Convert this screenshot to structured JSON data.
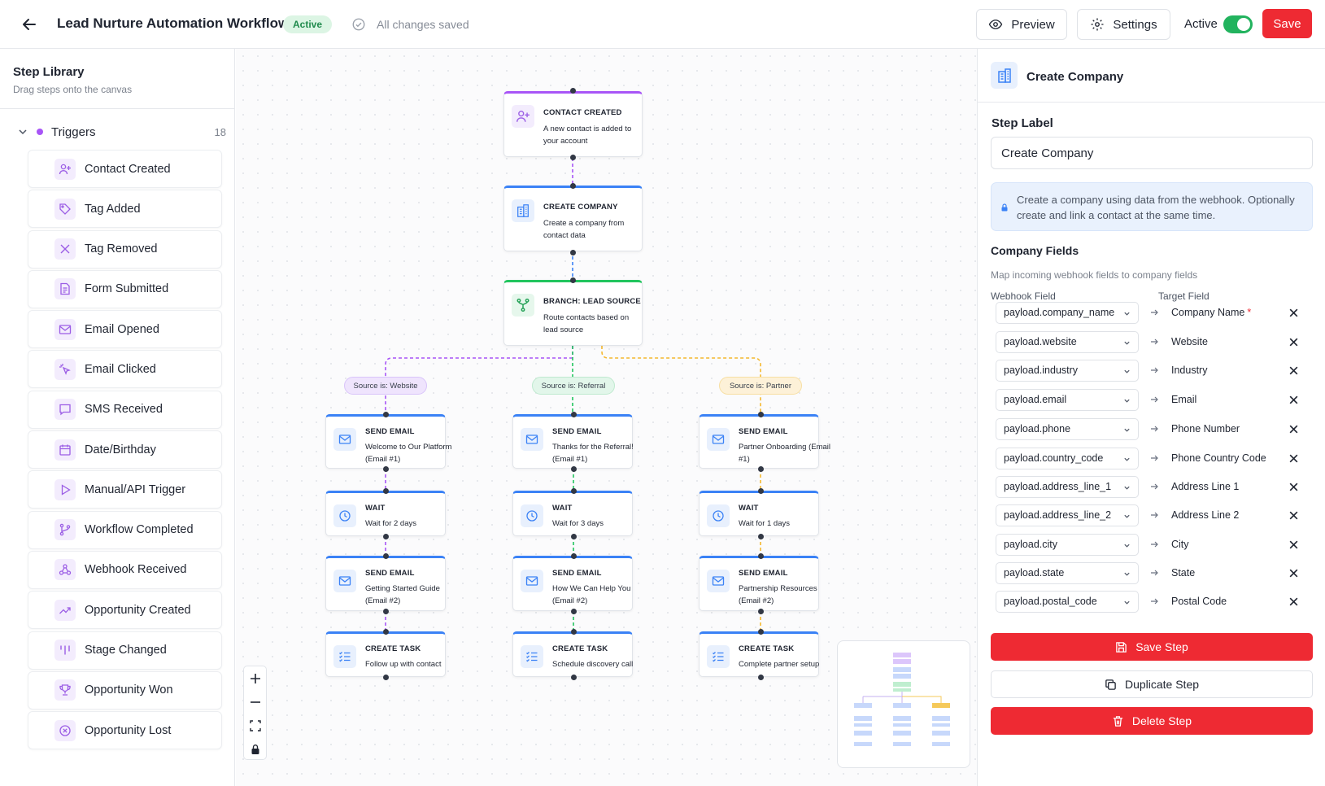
{
  "header": {
    "title": "Lead Nurture Automation Workflow",
    "status_badge": "Active",
    "save_status": "All changes saved",
    "preview_label": "Preview",
    "settings_label": "Settings",
    "active_label": "Active",
    "active_on": true,
    "save_label": "Save"
  },
  "sidebar": {
    "title": "Step Library",
    "subtitle": "Drag steps onto the canvas",
    "group_label": "Triggers",
    "group_count": "18",
    "items": [
      {
        "label": "Contact Created",
        "icon": "user-plus-icon"
      },
      {
        "label": "Tag Added",
        "icon": "tag-icon"
      },
      {
        "label": "Tag Removed",
        "icon": "x-icon"
      },
      {
        "label": "Form Submitted",
        "icon": "document-icon"
      },
      {
        "label": "Email Opened",
        "icon": "mail-icon"
      },
      {
        "label": "Email Clicked",
        "icon": "cursor-click-icon"
      },
      {
        "label": "SMS Received",
        "icon": "chat-icon"
      },
      {
        "label": "Date/Birthday",
        "icon": "calendar-icon"
      },
      {
        "label": "Manual/API Trigger",
        "icon": "play-icon"
      },
      {
        "label": "Workflow Completed",
        "icon": "branch-icon"
      },
      {
        "label": "Webhook Received",
        "icon": "webhook-icon"
      },
      {
        "label": "Opportunity Created",
        "icon": "trend-up-icon"
      },
      {
        "label": "Stage Changed",
        "icon": "columns-icon"
      },
      {
        "label": "Opportunity Won",
        "icon": "trophy-icon"
      },
      {
        "label": "Opportunity Lost",
        "icon": "x-circle-icon"
      }
    ]
  },
  "canvas": {
    "trigger": {
      "title": "CONTACT CREATED",
      "desc": "A new contact is added to your account"
    },
    "create_company": {
      "title": "CREATE COMPANY",
      "desc": "Create a company from contact data"
    },
    "branch": {
      "title": "BRANCH: LEAD SOURCE",
      "desc": "Route contacts based on lead source"
    },
    "branches": [
      {
        "label": "Source is: Website",
        "steps": [
          {
            "title": "SEND EMAIL",
            "desc": "Welcome to Our Platform (Email #1)"
          },
          {
            "title": "WAIT",
            "desc": "Wait for 2 days"
          },
          {
            "title": "SEND EMAIL",
            "desc": "Getting Started Guide (Email #2)"
          },
          {
            "title": "CREATE TASK",
            "desc": "Follow up with contact"
          }
        ]
      },
      {
        "label": "Source is: Referral",
        "steps": [
          {
            "title": "SEND EMAIL",
            "desc": "Thanks for the Referral! (Email #1)"
          },
          {
            "title": "WAIT",
            "desc": "Wait for 3 days"
          },
          {
            "title": "SEND EMAIL",
            "desc": "How We Can Help You (Email #2)"
          },
          {
            "title": "CREATE TASK",
            "desc": "Schedule discovery call"
          }
        ]
      },
      {
        "label": "Source is: Partner",
        "steps": [
          {
            "title": "SEND EMAIL",
            "desc": "Partner Onboarding (Email #1)"
          },
          {
            "title": "WAIT",
            "desc": "Wait for 1 days"
          },
          {
            "title": "SEND EMAIL",
            "desc": "Partnership Resources (Email #2)"
          },
          {
            "title": "CREATE TASK",
            "desc": "Complete partner setup"
          }
        ]
      }
    ],
    "colors": {
      "trigger": "#a855f7",
      "action": "#3b82f6",
      "branch": "#22c55e",
      "website": "#a855f7",
      "referral": "#22c55e",
      "partner": "#f5b82e"
    }
  },
  "panel": {
    "title": "Create Company",
    "step_label_heading": "Step Label",
    "step_label_value": "Create Company",
    "info_text": "Create a company using data from the webhook. Optionally create and link a contact at the same time.",
    "fields_title": "Company Fields",
    "fields_sub": "Map incoming webhook fields to company fields",
    "col_webhook": "Webhook Field",
    "col_target": "Target Field",
    "mappings": [
      {
        "source": "payload.company_name",
        "target": "Company Name",
        "required": "*"
      },
      {
        "source": "payload.website",
        "target": "Website",
        "required": ""
      },
      {
        "source": "payload.industry",
        "target": "Industry",
        "required": ""
      },
      {
        "source": "payload.email",
        "target": "Email",
        "required": ""
      },
      {
        "source": "payload.phone",
        "target": "Phone Number",
        "required": ""
      },
      {
        "source": "payload.country_code",
        "target": "Phone Country Code",
        "required": ""
      },
      {
        "source": "payload.address_line_1",
        "target": "Address Line 1",
        "required": ""
      },
      {
        "source": "payload.address_line_2",
        "target": "Address Line 2",
        "required": ""
      },
      {
        "source": "payload.city",
        "target": "City",
        "required": ""
      },
      {
        "source": "payload.state",
        "target": "State",
        "required": ""
      },
      {
        "source": "payload.postal_code",
        "target": "Postal Code",
        "required": ""
      }
    ],
    "save_step": "Save Step",
    "duplicate_step": "Duplicate Step",
    "delete_step": "Delete Step"
  }
}
